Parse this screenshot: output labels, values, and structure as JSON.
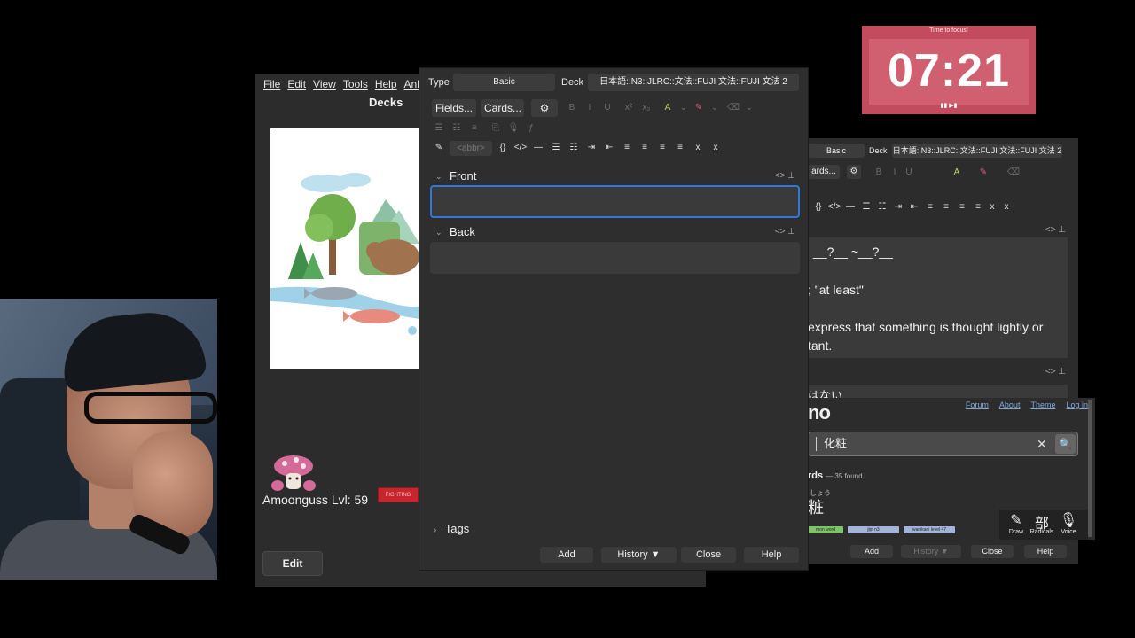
{
  "anki_main": {
    "menu": [
      "File",
      "Edit",
      "View",
      "Tools",
      "Help",
      "Anki"
    ],
    "decks_title": "Decks",
    "pet_label": "Amoonguss Lvl: 59",
    "fight_badge": "FIGHTING",
    "edit_button": "Edit"
  },
  "add_dialog": {
    "type_label": "Type",
    "type_value": "Basic",
    "deck_label": "Deck",
    "deck_value": "日本語::N3::JLRC::文法::FUJI 文法::FUJI 文法 2",
    "fields_button": "Fields...",
    "cards_button": "Cards...",
    "abbr_button": "<abbr>",
    "front_label": "Front",
    "back_label": "Back",
    "front_value": "",
    "back_value": "",
    "tags_label": "Tags",
    "buttons": {
      "add": "Add",
      "history": "History ▼",
      "close": "Close",
      "help": "Help"
    },
    "accent_color": "#2f7ad8"
  },
  "bg_dialog": {
    "type_value": "Basic",
    "deck_label": "Deck",
    "deck_value": "日本語::N3::JLRC::文法::FUJI 文法::FUJI 文法 2",
    "cards_button": "ards...",
    "lines": [
      "__?__ ~__?__",
      "; \"at least\"",
      "express that something is thought lightly or",
      "tant."
    ],
    "back_text": "はない"
  },
  "jisho": {
    "logo": "no",
    "links": [
      "Forum",
      "About",
      "Theme",
      "Log in"
    ],
    "search_value": "化粧",
    "words_heading": "rds",
    "found_count": "— 35 found",
    "furigana": "しょう",
    "kanji": "粧",
    "tags": [
      "mon word",
      "jlpt n3",
      "wanikani level 47"
    ],
    "tools": [
      {
        "glyph": "✎",
        "label": "Draw"
      },
      {
        "glyph": "部",
        "label": "Radicals"
      },
      {
        "glyph": "🎙",
        "label": "Voice"
      }
    ],
    "footer_buttons": [
      "Add",
      "History ▼",
      "Close",
      "Help"
    ]
  },
  "timer": {
    "caption": "Time to focus!",
    "time": "07:21",
    "controls": "▮▮ ▶▮",
    "color": "#c24c5d"
  }
}
